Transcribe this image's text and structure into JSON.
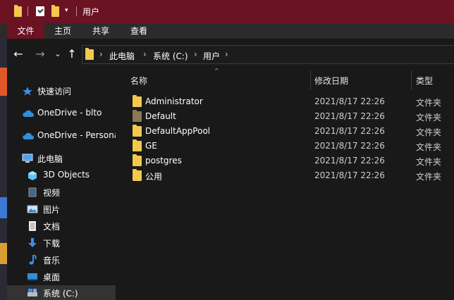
{
  "window": {
    "title": "用户",
    "qat_dropdown": "▾"
  },
  "ribbon": {
    "tabs": [
      {
        "label": "文件",
        "active": true
      },
      {
        "label": "主页",
        "active": false
      },
      {
        "label": "共享",
        "active": false
      },
      {
        "label": "查看",
        "active": false
      }
    ]
  },
  "nav": {
    "back": "←",
    "forward": "→",
    "recent": "⌄",
    "up": "↑",
    "crumbs": [
      "此电脑",
      "系统 (C:)",
      "用户"
    ],
    "chevron": "›"
  },
  "sidebar": {
    "items": [
      {
        "label": "快速访问",
        "icon": "star-icon"
      },
      {
        "label": "OneDrive - blto",
        "icon": "cloud-icon"
      },
      {
        "label": "OneDrive - Personal",
        "icon": "cloud-icon"
      },
      {
        "label": "此电脑",
        "icon": "computer-icon"
      },
      {
        "label": "3D Objects",
        "icon": "cube-icon"
      },
      {
        "label": "视频",
        "icon": "video-icon"
      },
      {
        "label": "图片",
        "icon": "picture-icon"
      },
      {
        "label": "文档",
        "icon": "document-icon"
      },
      {
        "label": "下载",
        "icon": "download-icon"
      },
      {
        "label": "音乐",
        "icon": "music-icon"
      },
      {
        "label": "桌面",
        "icon": "desktop-icon"
      },
      {
        "label": "系统 (C:)",
        "icon": "drive-icon",
        "selected": true
      }
    ]
  },
  "columns": {
    "name": "名称",
    "date": "修改日期",
    "type": "类型",
    "sort_indicator": "^"
  },
  "files": [
    {
      "name": "Administrator",
      "date": "2021/8/17 22:26",
      "type": "文件夹",
      "dim": false
    },
    {
      "name": "Default",
      "date": "2021/8/17 22:26",
      "type": "文件夹",
      "dim": true
    },
    {
      "name": "DefaultAppPool",
      "date": "2021/8/17 22:26",
      "type": "文件夹",
      "dim": false
    },
    {
      "name": "GE",
      "date": "2021/8/17 22:26",
      "type": "文件夹",
      "dim": false
    },
    {
      "name": "postgres",
      "date": "2021/8/17 22:26",
      "type": "文件夹",
      "dim": false
    },
    {
      "name": "公用",
      "date": "2021/8/17 22:26",
      "type": "文件夹",
      "dim": false
    }
  ],
  "colors": {
    "titlebar": "#6b1223",
    "folder": "#f3c94d",
    "background": "#191919",
    "selected": "#333333"
  }
}
